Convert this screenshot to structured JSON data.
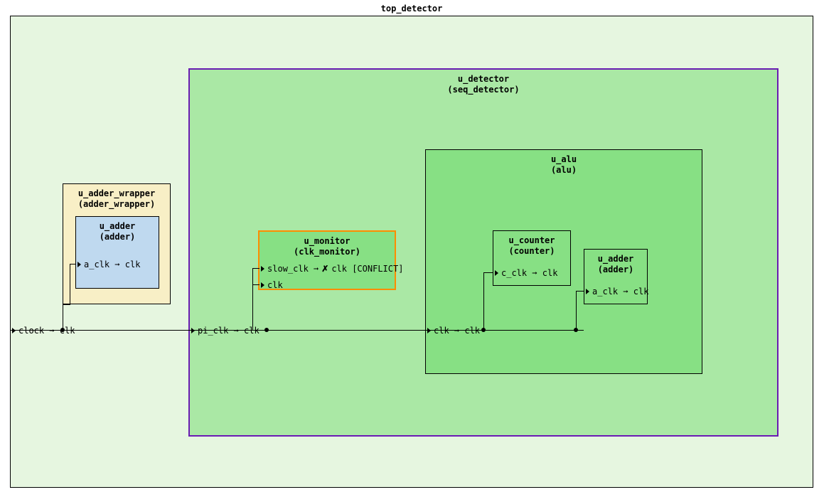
{
  "top_detector": {
    "title": "top_detector",
    "port": "clock ➞ clk"
  },
  "adder_wrapper": {
    "title1": "u_adder_wrapper",
    "title2": "(adder_wrapper)"
  },
  "adder_inner": {
    "title1": "u_adder",
    "title2": "(adder)",
    "port": "a_clk ➞ clk"
  },
  "detector": {
    "title1": "u_detector",
    "title2": "(seq_detector)",
    "port": "pi_clk ➞ clk"
  },
  "monitor": {
    "title1": "u_monitor",
    "title2": "(clk_monitor)",
    "port1_left": "slow_clk ➞",
    "port1_right": "clk [CONFLICT]",
    "port2": "clk"
  },
  "alu": {
    "title1": "u_alu",
    "title2": "(alu)",
    "port": "clk ➞ clk"
  },
  "counter": {
    "title1": "u_counter",
    "title2": "(counter)",
    "port": "c_clk ➞ clk"
  },
  "adder2": {
    "title1": "u_adder",
    "title2": "(adder)",
    "port": "a_clk ➞ clk"
  }
}
